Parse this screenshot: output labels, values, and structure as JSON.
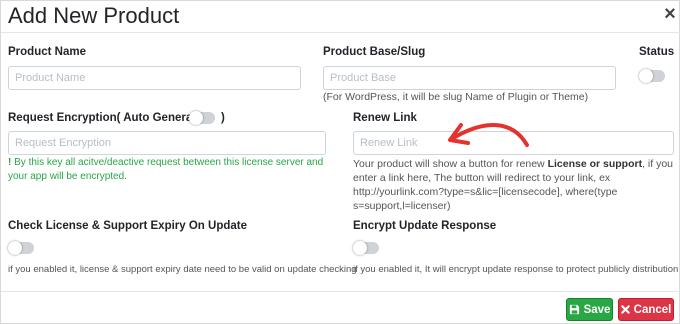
{
  "modal": {
    "title": "Add New Product",
    "close_glyph": "×"
  },
  "fields": {
    "product_name": {
      "label": "Product Name",
      "placeholder": "Product Name",
      "value": ""
    },
    "product_base": {
      "label": "Product Base/Slug",
      "placeholder": "Product Base",
      "value": "",
      "hint": "(For WordPress, it will be slug Name of Plugin or Theme)"
    },
    "status": {
      "label": "Status",
      "on": false
    },
    "request_encryption": {
      "label_prefix": "Request Encryption( Auto Generate?",
      "label_suffix": ")",
      "auto_generate_on": false,
      "placeholder": "Request Encryption",
      "value": "",
      "note_mark": "!",
      "note": " By this key all acitve/deactive request between this license server and your app will be encrypted."
    },
    "renew_link": {
      "label": "Renew Link",
      "placeholder": "Renew Link",
      "value": "",
      "help_pre": "Your product will show a button for renew ",
      "help_bold": "License or support",
      "help_post": ", if you enter a link here, The button will redirect to your link, ex http://yourlink.com?type=s&lic=[licensecode], where(type s=support,l=licenser)"
    },
    "check_expiry": {
      "label": "Check License & Support Expiry On Update",
      "on": false,
      "help": "if you enabled it, license & support expiry date need to be valid on update checking"
    },
    "encrypt_update": {
      "label": "Encrypt Update Response",
      "on": false,
      "help": "if you enabled it, It will encrypt update response to protect publicly distribution"
    }
  },
  "footer": {
    "save_label": "Save",
    "cancel_label": "Cancel"
  },
  "colors": {
    "save": "#28a745",
    "cancel": "#dc3545",
    "note": "#28a745",
    "annotation_arrow": "#e5322d"
  },
  "icons": {
    "close": "close-icon",
    "save": "save-icon",
    "cancel": "x-icon",
    "annotation": "curved-arrow-icon"
  }
}
